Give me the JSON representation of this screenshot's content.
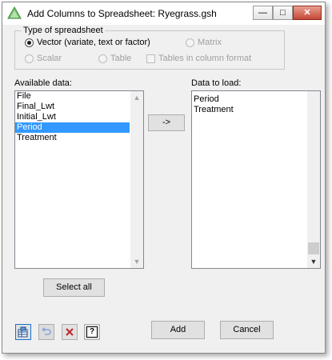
{
  "window": {
    "title": "Add Columns to Spreadsheet: Ryegrass.gsh",
    "minimize_glyph": "—",
    "maximize_glyph": "□",
    "close_glyph": "✕"
  },
  "spreadsheet_type": {
    "legend": "Type of spreadsheet",
    "options": [
      {
        "label": "Vector (variate, text or factor)",
        "checked": true,
        "enabled": true
      },
      {
        "label": "Matrix",
        "checked": false,
        "enabled": false
      },
      {
        "label": "Scalar",
        "checked": false,
        "enabled": false
      },
      {
        "label": "Table",
        "checked": false,
        "enabled": false
      }
    ],
    "tables_in_column_format": {
      "label": "Tables in column format",
      "checked": false,
      "enabled": false
    }
  },
  "available_data": {
    "label": "Available data:",
    "items": [
      "File",
      "Final_Lwt",
      "Initial_Lwt",
      "Period",
      "Treatment"
    ],
    "selected": "Period"
  },
  "transfer_button": {
    "label": "->"
  },
  "data_to_load": {
    "label": "Data to load:",
    "items": [
      "Period",
      "Treatment"
    ]
  },
  "select_all_button": {
    "label": "Select all"
  },
  "icons": {
    "spreadsheet": "spreadsheet-icon",
    "undo": "undo-icon",
    "clear": "clear-x-icon",
    "help": "help-icon",
    "help_glyph": "?"
  },
  "add_button": {
    "label": "Add"
  },
  "cancel_button": {
    "label": "Cancel"
  },
  "colors": {
    "selection": "#3399ff",
    "window_bg": "#f0f0f0",
    "close_red": "#c64836",
    "clear_red": "#c0282d"
  }
}
